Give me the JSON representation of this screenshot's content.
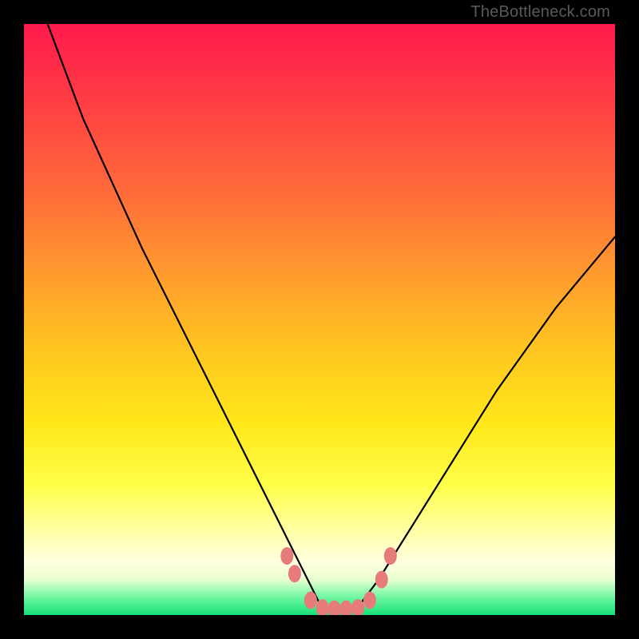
{
  "watermark": "TheBottleneck.com",
  "chart_data": {
    "type": "line",
    "title": "",
    "xlabel": "",
    "ylabel": "",
    "xlim": [
      0,
      100
    ],
    "ylim": [
      0,
      100
    ],
    "series": [
      {
        "name": "bottleneck-curve",
        "x": [
          4,
          10,
          20,
          30,
          40,
          45,
          48,
          50,
          52,
          54,
          57,
          60,
          65,
          70,
          80,
          90,
          100
        ],
        "values": [
          100,
          84,
          62,
          42,
          22,
          12,
          6,
          2,
          1,
          1,
          2,
          6,
          14,
          22,
          38,
          52,
          64
        ]
      }
    ],
    "markers": [
      {
        "x": 44.5,
        "y": 10
      },
      {
        "x": 45.8,
        "y": 7
      },
      {
        "x": 48.5,
        "y": 2.5
      },
      {
        "x": 50.5,
        "y": 1.2
      },
      {
        "x": 52.5,
        "y": 1.0
      },
      {
        "x": 54.5,
        "y": 1.0
      },
      {
        "x": 56.5,
        "y": 1.2
      },
      {
        "x": 58.5,
        "y": 2.5
      },
      {
        "x": 60.5,
        "y": 6
      },
      {
        "x": 62.0,
        "y": 10
      }
    ],
    "gradient_stops": [
      {
        "pos": 0,
        "color": "#ff1a4d"
      },
      {
        "pos": 28,
        "color": "#ff6a3a"
      },
      {
        "pos": 56,
        "color": "#ffc81f"
      },
      {
        "pos": 78,
        "color": "#ffff4a"
      },
      {
        "pos": 91,
        "color": "#ffffe0"
      },
      {
        "pos": 100,
        "color": "#17e07a"
      }
    ]
  }
}
